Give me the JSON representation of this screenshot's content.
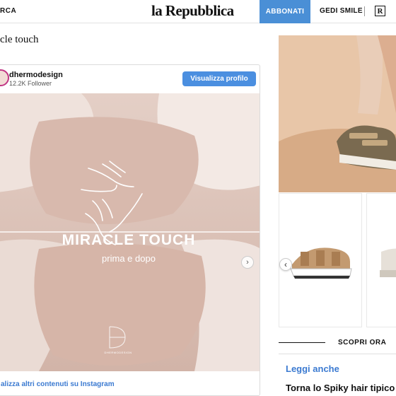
{
  "topbar": {
    "search_label": "RCA",
    "brand": "la Repubblica",
    "subscribe_label": "ABBONATI",
    "gedi_label": "GEDI SMILE",
    "r_logo": "R"
  },
  "article": {
    "title": "cle touch"
  },
  "instagram": {
    "handle": "dhermodesign",
    "followers": "12.2K Follower",
    "view_profile_label": "Visualizza profilo",
    "post_title": "MIRACLE TOUCH",
    "post_subtitle": "prima e dopo",
    "watermark": "DHERMODESIGN",
    "more_link": "alizza altri contenuti su Instagram",
    "slide_index": 1,
    "slide_count": 2,
    "next_icon": "chevron-right-icon"
  },
  "sidebar": {
    "prev_icon": "chevron-left-icon",
    "cta_label": "SCOPRI ORA",
    "related_heading": "Leggi anche",
    "related_headline": "Torna lo Spiky hair tipico"
  },
  "colors": {
    "accent_blue": "#4a8fd6",
    "link_blue": "#3b7ad1",
    "photo_tone": "#dcc4b9",
    "ad_tone": "#e5c1a1"
  }
}
